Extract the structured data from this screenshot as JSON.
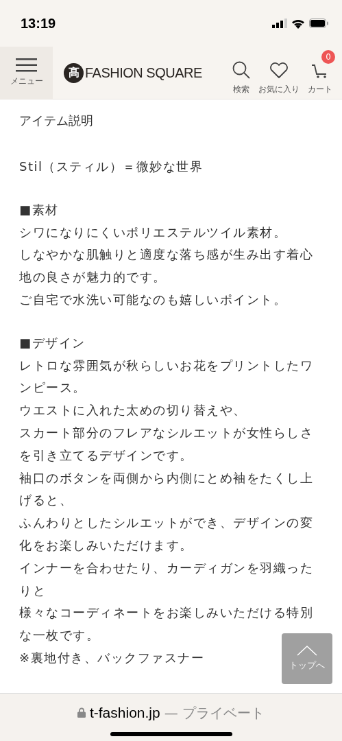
{
  "status_bar": {
    "time": "13:19"
  },
  "header": {
    "menu_label": "メニュー",
    "logo_mark": "髙",
    "logo_text": "FASHION SQUARE",
    "actions": [
      {
        "kind": "search",
        "label": "検索"
      },
      {
        "kind": "favorite",
        "label": "お気に入り"
      },
      {
        "kind": "cart",
        "label": "カート",
        "badge": "0"
      }
    ]
  },
  "section_title": "アイテム説明",
  "blocks": [
    {
      "lines": [
        "Stil（スティル）＝微妙な世界"
      ]
    },
    {
      "lines": [
        "■素材",
        "シワになりにくいポリエステルツイル素材。",
        "しなやかな肌触りと適度な落ち感が生み出す着心",
        "地の良さが魅力的です。",
        "ご自宅で水洗い可能なのも嬉しいポイント。"
      ]
    },
    {
      "lines": [
        "■デザイン",
        "レトロな雰囲気が秋らしいお花をプリントしたワ",
        "ンピース。",
        "ウエストに入れた太めの切り替えや、",
        "スカート部分のフレアなシルエットが女性らしさ",
        "を引き立てるデザインです。",
        "袖口のボタンを両側から内側にとめ袖をたくし上",
        "げると、",
        "ふんわりとしたシルエットができ、デザインの変",
        "化をお楽しみいただけます。",
        "インナーを合わせたり、カーディガンを羽織った",
        "りと",
        "様々なコーディネートをお楽しみいただける特別",
        "な一枚です。",
        "※裏地付き、バックファスナー"
      ]
    }
  ],
  "back_to_top": {
    "label": "トップへ"
  },
  "browser_bar": {
    "domain": "t-fashion.jp",
    "suffix": "— プライベート"
  }
}
